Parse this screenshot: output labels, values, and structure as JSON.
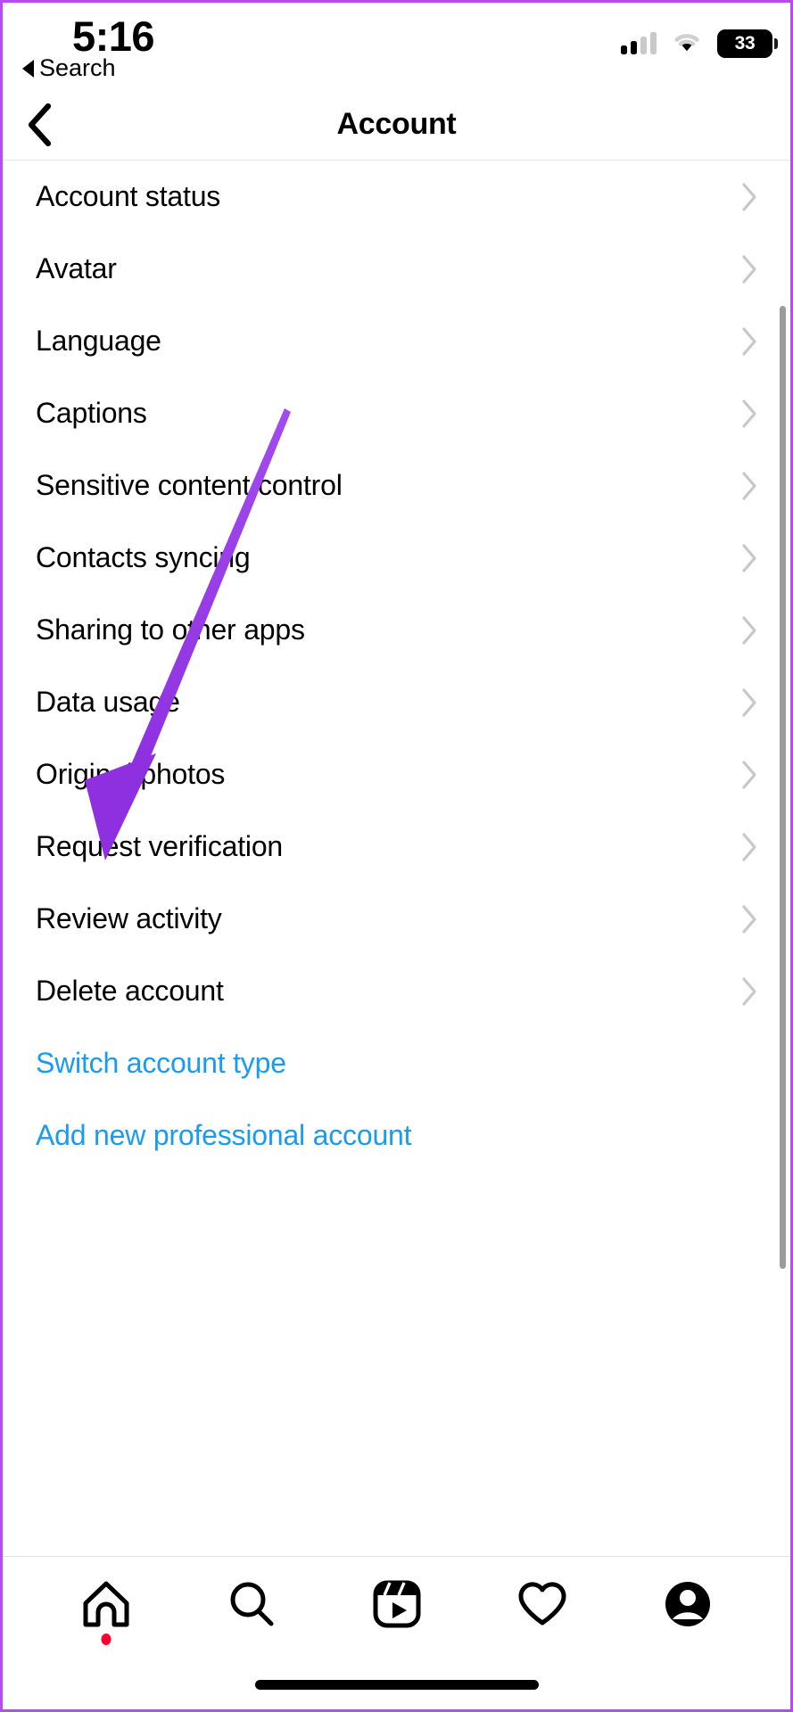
{
  "status_bar": {
    "time": "5:16",
    "back_app_label": "Search",
    "back_app_icon": "triangle-left-icon",
    "signal_icon": "cellular-signal-icon",
    "signal_bars_filled": 2,
    "signal_bars_total": 4,
    "wifi_icon": "wifi-icon",
    "battery_icon": "battery-icon",
    "battery_level": "33"
  },
  "nav": {
    "back_icon": "chevron-left-icon",
    "title": "Account"
  },
  "settings_rows": [
    {
      "label": "Account status",
      "chevron": "chevron-right-icon"
    },
    {
      "label": "Avatar",
      "chevron": "chevron-right-icon"
    },
    {
      "label": "Language",
      "chevron": "chevron-right-icon"
    },
    {
      "label": "Captions",
      "chevron": "chevron-right-icon"
    },
    {
      "label": "Sensitive content control",
      "chevron": "chevron-right-icon"
    },
    {
      "label": "Contacts syncing",
      "chevron": "chevron-right-icon"
    },
    {
      "label": "Sharing to other apps",
      "chevron": "chevron-right-icon"
    },
    {
      "label": "Data usage",
      "chevron": "chevron-right-icon"
    },
    {
      "label": "Original photos",
      "chevron": "chevron-right-icon"
    },
    {
      "label": "Request verification",
      "chevron": "chevron-right-icon"
    },
    {
      "label": "Review activity",
      "chevron": "chevron-right-icon"
    },
    {
      "label": "Delete account",
      "chevron": "chevron-right-icon"
    }
  ],
  "action_links": [
    {
      "label": "Switch account type"
    },
    {
      "label": "Add new professional account"
    }
  ],
  "tab_bar": [
    {
      "name": "home",
      "icon": "home-icon",
      "badge_dot": true
    },
    {
      "name": "search",
      "icon": "search-icon",
      "badge_dot": false
    },
    {
      "name": "reels",
      "icon": "reels-icon",
      "badge_dot": false
    },
    {
      "name": "activity",
      "icon": "heart-icon",
      "badge_dot": false
    },
    {
      "name": "profile",
      "icon": "profile-avatar-icon",
      "badge_dot": false
    }
  ],
  "annotation": {
    "type": "arrow",
    "points_to": "Data usage",
    "color": "#9B3FE8"
  },
  "colors": {
    "link_blue": "#1a9bf0",
    "annotation_purple": "#9B3FE8",
    "badge_red": "#ff0033",
    "chevron_gray": "#c7c7cc",
    "scrollbar_gray": "#9b9b9b",
    "frame_purple": "#b44cf0"
  },
  "scrollbar": {
    "name": "vertical-scrollbar"
  }
}
